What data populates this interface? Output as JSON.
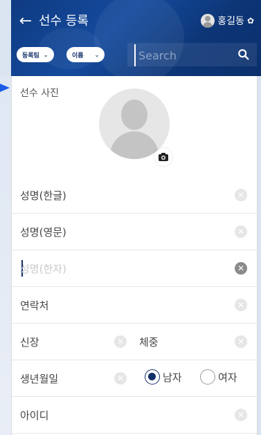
{
  "header": {
    "title": "선수 등록",
    "username": "홍길동",
    "filters": [
      {
        "label": "등록팀"
      },
      {
        "label": "이름"
      }
    ],
    "search_placeholder": "Search"
  },
  "form": {
    "photo_label": "선수 사진",
    "name_korean": "성명(한글)",
    "name_english": "성명(영문)",
    "name_hanja_placeholder": "성명(한자)",
    "contact": "연락처",
    "height": "신장",
    "weight": "체중",
    "birthdate": "생년월일",
    "gender_male": "남자",
    "gender_female": "여자",
    "user_id": "아이디"
  },
  "colors": {
    "header_bg": "#0f3b82",
    "accent": "#11306a",
    "marker": "#1a5be8"
  },
  "icons": [
    "back-arrow-icon",
    "user-avatar-icon",
    "gear-icon",
    "search-icon",
    "camera-icon",
    "clear-icon",
    "chevron-down-icon"
  ]
}
